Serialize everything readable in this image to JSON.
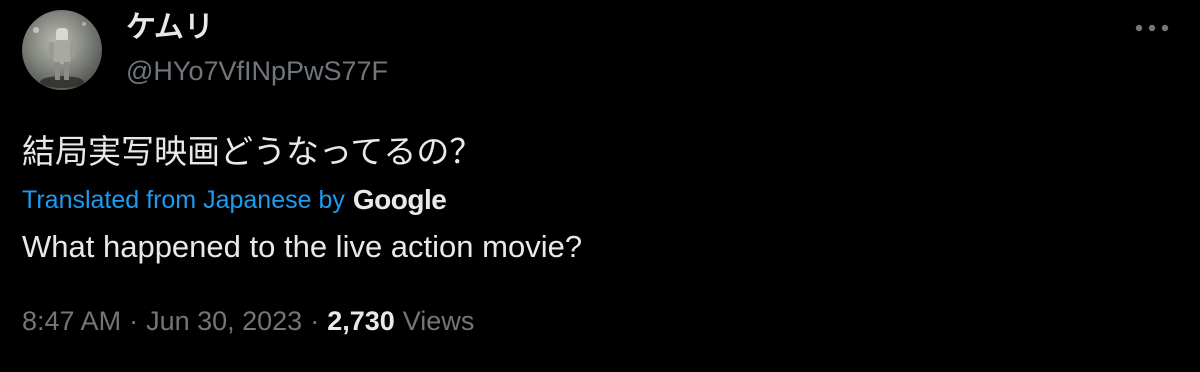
{
  "author": {
    "display_name": "ケムリ",
    "handle": "@HYo7VfINpPwS77F"
  },
  "tweet": {
    "text": "結局実写映画どうなってるの？",
    "translation": {
      "label": "Translated from Japanese by",
      "provider": "Google",
      "text": "What happened to the live action movie?"
    },
    "time": "8:47 AM",
    "separator": "·",
    "date": "Jun 30, 2023",
    "views_count": "2,730",
    "views_label": "Views"
  },
  "icons": {
    "more": "more-horizontal-icon",
    "avatar": "avatar-image"
  },
  "colors": {
    "background": "#000000",
    "primary_text": "#e7e9ea",
    "secondary_text": "#71767b",
    "link": "#1d9bf0"
  }
}
